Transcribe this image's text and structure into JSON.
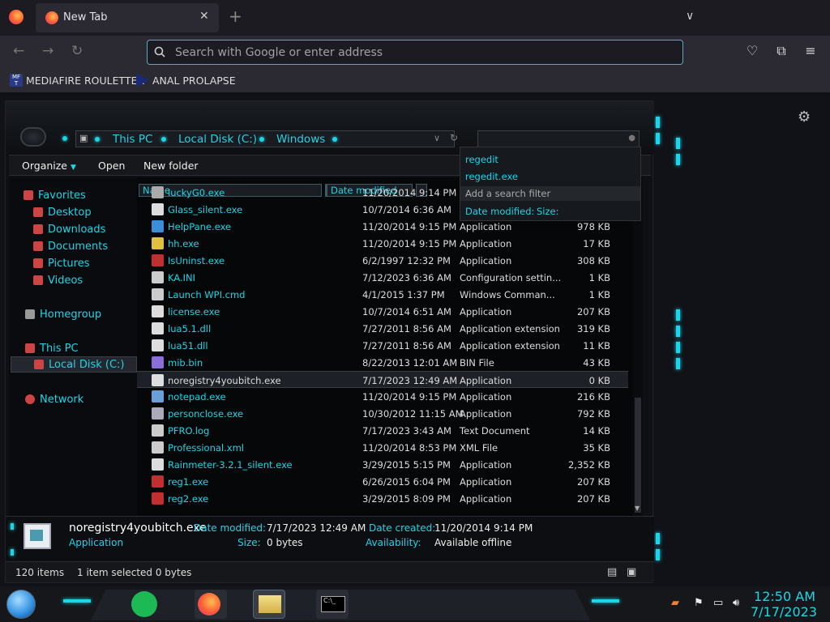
{
  "browser": {
    "tab_title": "New Tab",
    "url_placeholder": "Search with Google or enter address",
    "bookmarks": [
      {
        "label": "MEDIAFIRE ROULETTER",
        "icon_text": "MF\nT"
      },
      {
        "label": "ANAL PROLAPSE",
        "icon_text": ""
      }
    ]
  },
  "explorer": {
    "breadcrumb": [
      "This PC",
      "Local Disk (C:)",
      "Windows"
    ],
    "search_dropdown": {
      "suggestions": [
        "regedit",
        "regedit.exe"
      ],
      "filter_label": "Add a search filter",
      "filters": [
        "Date modified:",
        "Size:"
      ]
    },
    "toolbar": {
      "organize": "Organize",
      "open": "Open",
      "new_folder": "New folder"
    },
    "nav": [
      {
        "label": "Favorites",
        "icon_color": "#c44"
      },
      {
        "label": "Desktop",
        "icon_color": "#c44"
      },
      {
        "label": "Downloads",
        "icon_color": "#c44"
      },
      {
        "label": "Documents",
        "icon_color": "#c44"
      },
      {
        "label": "Pictures",
        "icon_color": "#c44"
      },
      {
        "label": "Videos",
        "icon_color": "#c44"
      },
      {
        "label": "Homegroup",
        "icon_color": "#999"
      },
      {
        "label": "This PC",
        "icon_color": "#c44"
      },
      {
        "label": "Local Disk (C:)",
        "icon_color": "#c44"
      },
      {
        "label": "Network",
        "icon_color": "#c44"
      }
    ],
    "columns": {
      "name": "Name",
      "date": "Date modified"
    },
    "files": [
      {
        "name": "luckyG0.exe",
        "date": "11/20/2014 9:14 PM",
        "type": "",
        "size": "",
        "icon_color": "#aaa"
      },
      {
        "name": "Glass_silent.exe",
        "date": "10/7/2014 6:36 AM",
        "type": "",
        "size": "",
        "icon_color": "#ddd"
      },
      {
        "name": "HelpPane.exe",
        "date": "11/20/2014 9:15 PM",
        "type": "Application",
        "size": "978 KB",
        "icon_color": "#3a8fd8"
      },
      {
        "name": "hh.exe",
        "date": "11/20/2014 9:15 PM",
        "type": "Application",
        "size": "17 KB",
        "icon_color": "#e0c040"
      },
      {
        "name": "IsUninst.exe",
        "date": "6/2/1997 12:32 PM",
        "type": "Application",
        "size": "308 KB",
        "icon_color": "#c03030"
      },
      {
        "name": "KA.INI",
        "date": "7/12/2023 6:36 AM",
        "type": "Configuration settin...",
        "size": "1 KB",
        "icon_color": "#ccc"
      },
      {
        "name": "Launch WPI.cmd",
        "date": "4/1/2015 1:37 PM",
        "type": "Windows Comman...",
        "size": "1 KB",
        "icon_color": "#ccc"
      },
      {
        "name": "license.exe",
        "date": "10/7/2014 6:51 AM",
        "type": "Application",
        "size": "207 KB",
        "icon_color": "#ddd"
      },
      {
        "name": "lua5.1.dll",
        "date": "7/27/2011 8:56 AM",
        "type": "Application extension",
        "size": "319 KB",
        "icon_color": "#ddd"
      },
      {
        "name": "lua51.dll",
        "date": "7/27/2011 8:56 AM",
        "type": "Application extension",
        "size": "11 KB",
        "icon_color": "#ddd"
      },
      {
        "name": "mib.bin",
        "date": "8/22/2013 12:01 AM",
        "type": "BIN File",
        "size": "43 KB",
        "icon_color": "#8a6fd8"
      },
      {
        "name": "noregistry4youbitch.exe",
        "date": "7/17/2023 12:49 AM",
        "type": "Application",
        "size": "0 KB",
        "icon_color": "#ddd"
      },
      {
        "name": "notepad.exe",
        "date": "11/20/2014 9:15 PM",
        "type": "Application",
        "size": "216 KB",
        "icon_color": "#6aa0d8"
      },
      {
        "name": "personclose.exe",
        "date": "10/30/2012 11:15 AM",
        "type": "Application",
        "size": "792 KB",
        "icon_color": "#aab"
      },
      {
        "name": "PFRO.log",
        "date": "7/17/2023 3:43 AM",
        "type": "Text Document",
        "size": "14 KB",
        "icon_color": "#ccc"
      },
      {
        "name": "Professional.xml",
        "date": "11/20/2014 8:53 PM",
        "type": "XML File",
        "size": "35 KB",
        "icon_color": "#ccc"
      },
      {
        "name": "Rainmeter-3.2.1_silent.exe",
        "date": "3/29/2015 5:15 PM",
        "type": "Application",
        "size": "2,352 KB",
        "icon_color": "#ddd"
      },
      {
        "name": "reg1.exe",
        "date": "6/26/2015 6:04 PM",
        "type": "Application",
        "size": "207 KB",
        "icon_color": "#c03030"
      },
      {
        "name": "reg2.exe",
        "date": "3/29/2015 8:09 PM",
        "type": "Application",
        "size": "207 KB",
        "icon_color": "#c03030"
      }
    ],
    "details": {
      "filename": "noregistry4youbitch.exe",
      "type": "Application",
      "date_modified_label": "Date modified:",
      "date_modified": "7/17/2023 12:49 AM",
      "date_created_label": "Date created:",
      "date_created": "11/20/2014 9:14 PM",
      "size_label": "Size:",
      "size": "0 bytes",
      "availability_label": "Availability:",
      "availability": "Available offline"
    },
    "status": {
      "items": "120 items",
      "selected": "1 item selected  0 bytes"
    }
  },
  "taskbar": {
    "time": "12:50 AM",
    "date": "7/17/2023",
    "cmd_label": "C:\\_"
  },
  "colors": {
    "accent": "#1dd5e6"
  }
}
